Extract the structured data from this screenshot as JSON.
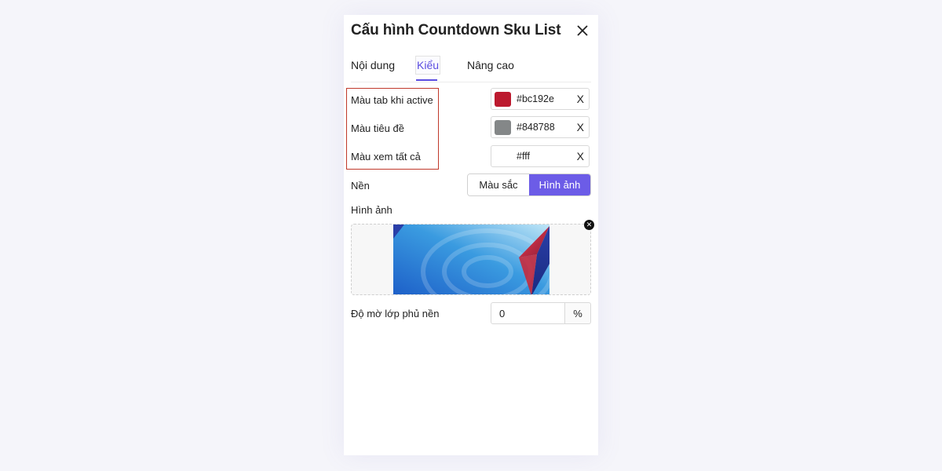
{
  "dialog": {
    "title": "Cấu hình Countdown Sku List"
  },
  "tabs": [
    {
      "label": "Nội dung",
      "active": false
    },
    {
      "label": "Kiểu",
      "active": true
    },
    {
      "label": "Nâng cao",
      "active": false
    }
  ],
  "accent_color": "#6c5ce7",
  "colors": [
    {
      "label": "Màu tab khi active",
      "value": "#bc192e",
      "swatch": "#bc192e",
      "clear": "X"
    },
    {
      "label": "Màu tiêu đề",
      "value": "#848788",
      "swatch": "#848788",
      "clear": "X"
    },
    {
      "label": "Màu xem tất cả",
      "value": "#fff",
      "swatch": "#ffffff",
      "clear": "X"
    }
  ],
  "background": {
    "label": "Nền",
    "options": [
      "Màu sắc",
      "Hình ảnh"
    ],
    "selected": "Hình ảnh"
  },
  "image": {
    "label": "Hình ảnh"
  },
  "overlay": {
    "label": "Độ mờ lớp phủ nền",
    "value": "0",
    "unit": "%"
  }
}
